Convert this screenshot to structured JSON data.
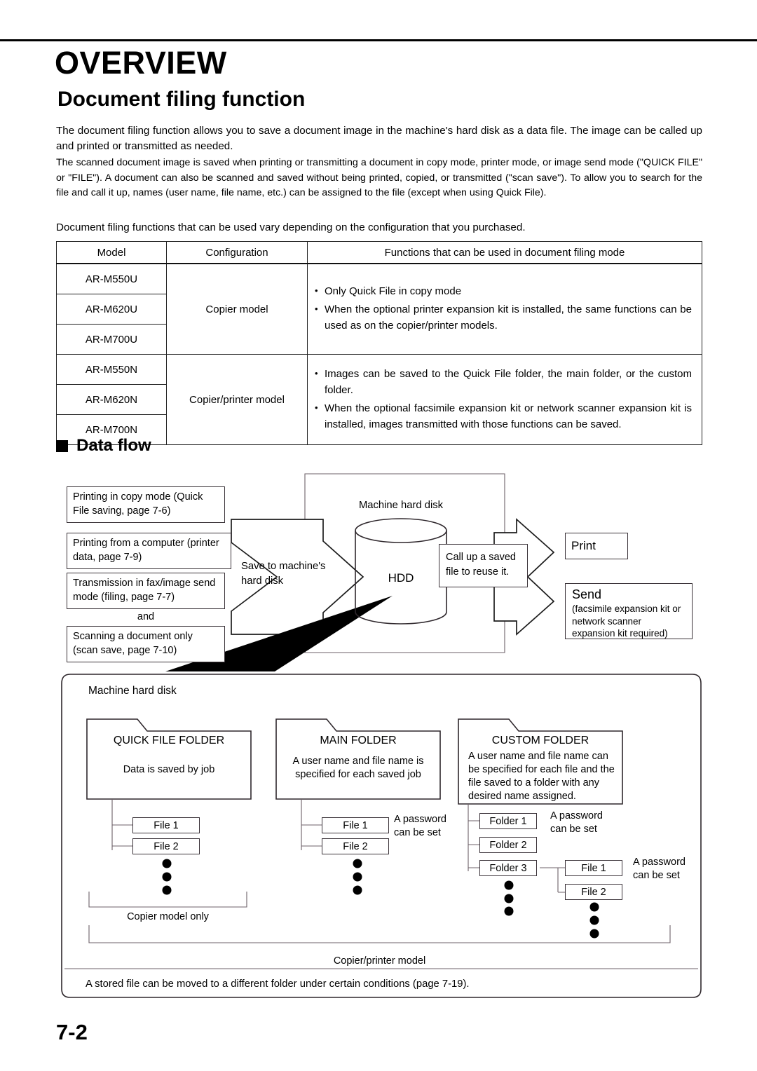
{
  "page": {
    "chapter_title": "OVERVIEW",
    "section_title": "Document filing function",
    "page_number": "7-2"
  },
  "intro": {
    "paragraph_1": "The document filing function allows you to save a document image in the machine's hard disk as a data file. The image can be called up and printed or transmitted as needed.",
    "paragraph_2": "The scanned document image is saved when printing or transmitting a document in copy mode, printer mode, or image send mode (\"QUICK FILE\" or \"FILE\"). A document can also be scanned and saved without being printed, copied, or transmitted (\"scan save\"). To allow you to search for the file and call it up, names (user name, file name, etc.) can be assigned to the file (except when using Quick File).",
    "paragraph_3": "Document filing functions that can be used vary depending on the configuration that you purchased."
  },
  "model_table": {
    "headers": [
      "Model",
      "Configuration",
      "Functions that can be used in document filing mode"
    ],
    "groups": [
      {
        "models": [
          "AR-M550U",
          "AR-M620U",
          "AR-M700U"
        ],
        "configuration": "Copier model",
        "functions": [
          "Only Quick File in copy mode",
          "When the optional printer expansion kit is installed, the same functions can be used as on the copier/printer models."
        ]
      },
      {
        "models": [
          "AR-M550N",
          "AR-M620N",
          "AR-M700N"
        ],
        "configuration": "Copier/printer model",
        "functions": [
          "Images can be saved to the Quick File folder, the main folder, or the custom folder.",
          "When the optional facsimile expansion kit or network scanner expansion kit is installed, images transmitted with those functions can be saved."
        ]
      }
    ]
  },
  "data_flow": {
    "heading": "Data flow",
    "sources": [
      "Printing in copy mode (Quick File saving, page 7-6)",
      "Printing from a computer (printer data, page 7-9)",
      "Transmission in fax/image send mode (filing, page 7-7)"
    ],
    "and_label": "and",
    "source_last": "Scanning a document only (scan save, page 7-10)",
    "arrow_in_label": "Save to machine's hard disk",
    "hdd_caption": "Machine hard disk",
    "hdd_label": "HDD",
    "arrow_out_label": "Call up a saved file to reuse it.",
    "outputs": [
      {
        "title": "Print",
        "detail": ""
      },
      {
        "title": "Send",
        "detail": "(facsimile expansion kit or network scanner expansion kit required)"
      }
    ]
  },
  "storage_diagram": {
    "caption": "Machine hard disk",
    "folders": [
      {
        "name": "QUICK FILE FOLDER",
        "description": "Data is saved by job",
        "children": [
          "File 1",
          "File 2"
        ],
        "password_note": ""
      },
      {
        "name": "MAIN FOLDER",
        "description": "A user name and file name is specified for each saved job",
        "children": [
          "File 1",
          "File 2"
        ],
        "password_note": "A password can be set"
      },
      {
        "name": "CUSTOM FOLDER",
        "description": "A user name and file name can be specified for each file and the file saved to a folder with any desired name assigned.",
        "children": [
          "Folder 1",
          "Folder 2",
          "Folder 3"
        ],
        "password_note": "A password can be set",
        "subchildren": [
          "File 1",
          "File 2"
        ],
        "sub_password_note": "A password can be set"
      }
    ],
    "bracket_labels": {
      "copier_only": "Copier model only",
      "copier_printer": "Copier/printer model"
    },
    "footnote": "A stored file can be moved to a different folder under certain conditions (page 7-19)."
  }
}
